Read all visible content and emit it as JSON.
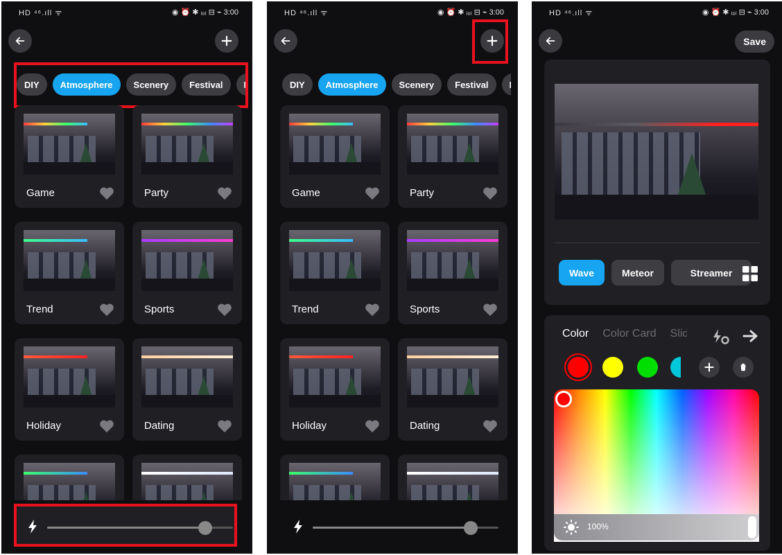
{
  "status_bar": {
    "left": "HD ⁴⁶.ıll ᯤ",
    "right": "◉ ⏰ ✱ ᵢ₀ᵢ ⊟ ⌁ 3:00"
  },
  "colors": {
    "accent": "#17a4f0",
    "highlight": "#e8121e",
    "background": "#0f0f12",
    "card": "#1f1f24"
  },
  "icons": {
    "back": "arrow-left-icon",
    "add": "plus-icon",
    "favorite": "heart-icon",
    "brightness": "bolt-icon"
  },
  "scene_list": {
    "tabs": [
      {
        "label": "DIY",
        "active": false
      },
      {
        "label": "Atmosphere",
        "active": true
      },
      {
        "label": "Scenery",
        "active": false
      },
      {
        "label": "Festival",
        "active": false
      },
      {
        "label": "M",
        "active": false
      }
    ],
    "cards": [
      {
        "name": "Game",
        "light": "linear-gradient(90deg,#ff3b3b,#ffd23b,#3bff6a,#3bbcff)"
      },
      {
        "name": "Party",
        "light": "linear-gradient(90deg,#ff3b3b,#ffd23b,#3bff6a,#3b8cff,#c83bff)"
      },
      {
        "name": "Trend",
        "light": "linear-gradient(90deg,#3bff8a,#3bbcff)"
      },
      {
        "name": "Sports",
        "light": "linear-gradient(90deg,#a83bff,#ff3bd8)"
      },
      {
        "name": "Holiday",
        "light": "linear-gradient(90deg,#ff5a3b,#ff2020)"
      },
      {
        "name": "Dating",
        "light": "linear-gradient(90deg,#ffd0a0,#fff0d8)"
      },
      {
        "name": "",
        "light": "linear-gradient(90deg,#3bff6a,#3b8cff)"
      },
      {
        "name": "",
        "light": "linear-gradient(90deg,#ffffff,#dfeaff)"
      }
    ],
    "brightness_level": 0.85
  },
  "editor": {
    "save_label": "Save",
    "modes": [
      {
        "label": "Wave",
        "active": true
      },
      {
        "label": "Meteor",
        "active": false
      },
      {
        "label": "Streamer",
        "active": false
      }
    ],
    "color_tabs": [
      {
        "label": "Color",
        "active": true
      },
      {
        "label": "Color Card",
        "active": false
      },
      {
        "label": "Slid",
        "active": false
      }
    ],
    "swatches": [
      "#ff0000",
      "#ffff00",
      "#00dd00",
      "#00c8d8"
    ],
    "brightness_text": "100%"
  }
}
